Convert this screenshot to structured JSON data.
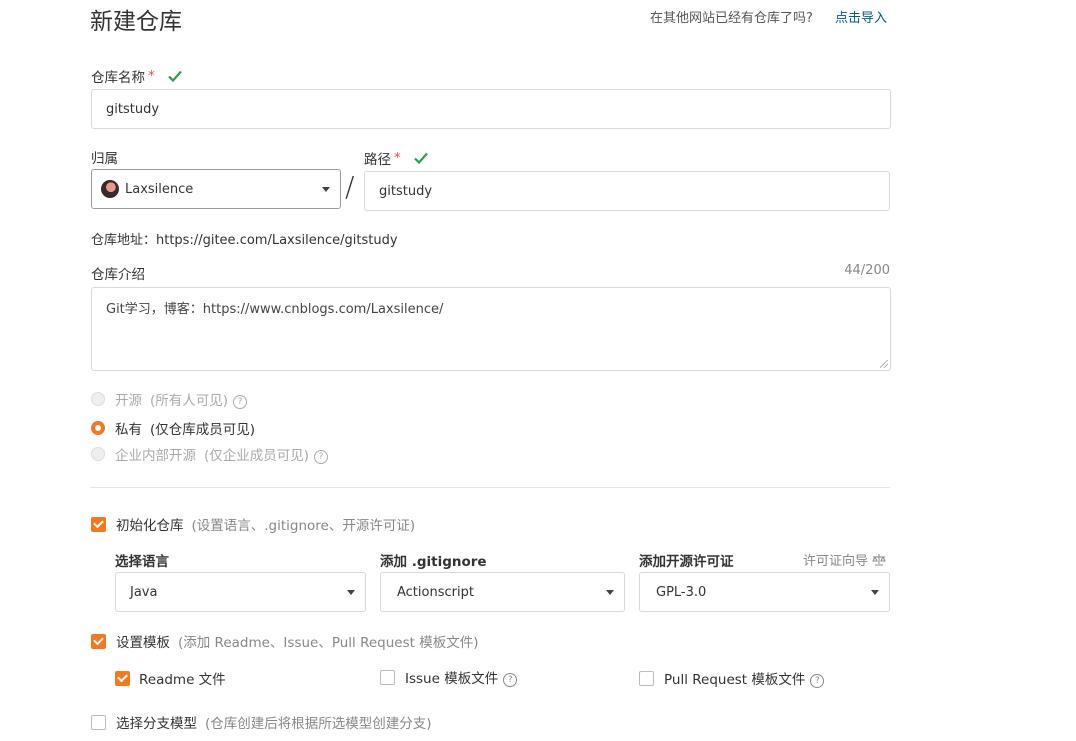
{
  "header": {
    "title": "新建仓库",
    "import_question": "在其他网站已经有仓库了吗?",
    "import_link": "点击导入"
  },
  "repo_name": {
    "label": "仓库名称",
    "required_mark": "*",
    "value": "gitstudy"
  },
  "owner": {
    "label": "归属",
    "selected": "Laxsilence"
  },
  "path": {
    "separator": "/",
    "label": "路径",
    "required_mark": "*",
    "value": "gitstudy"
  },
  "repo_url": {
    "text": "仓库地址：https://gitee.com/Laxsilence/gitstudy"
  },
  "description": {
    "label": "仓库介绍",
    "counter": "44/200",
    "value": "Git学习，博客：https://www.cnblogs.com/Laxsilence/"
  },
  "visibility": {
    "options": [
      {
        "label": "开源",
        "note": "(所有人可见)",
        "selected": false,
        "disabled": true
      },
      {
        "label": "私有",
        "note": "(仅仓库成员可见)",
        "selected": true,
        "disabled": false
      },
      {
        "label": "企业内部开源",
        "note": "(仅企业成员可见)",
        "selected": false,
        "disabled": true
      }
    ]
  },
  "init_repo": {
    "label": "初始化仓库",
    "hint": "(设置语言、.gitignore、开源许可证)",
    "checked": true,
    "language_label": "选择语言",
    "language_value": "Java",
    "gitignore_label": "添加 .gitignore",
    "gitignore_value": "Actionscript",
    "license_label": "添加开源许可证",
    "license_guide": "许可证向导",
    "license_value": "GPL-3.0"
  },
  "template": {
    "label": "设置模板",
    "hint": "(添加 Readme、Issue、Pull Request 模板文件)",
    "checked": true,
    "readme_label": "Readme 文件",
    "readme_checked": true,
    "issue_label": "Issue 模板文件",
    "issue_checked": false,
    "pr_label": "Pull Request 模板文件",
    "pr_checked": false
  },
  "branch_model": {
    "label": "选择分支模型",
    "hint": "(仓库创建后将根据所选模型创建分支)",
    "checked": false
  },
  "colors": {
    "accent": "#f37821",
    "link": "#005980",
    "valid": "#2e9e4f",
    "required": "#d9534f"
  }
}
